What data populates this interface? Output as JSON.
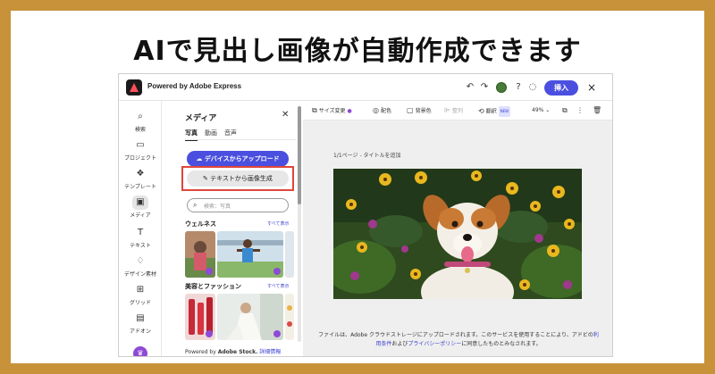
{
  "headline": "AIで見出し画像が自動作成できます",
  "app": {
    "title": "Powered by Adobe Express",
    "insert_label": "挿入",
    "close_icon": "×"
  },
  "nav": [
    {
      "label": "検索",
      "icon": "search-icon"
    },
    {
      "label": "プロジェクト",
      "icon": "folder-icon"
    },
    {
      "label": "テンプレート",
      "icon": "template-icon"
    },
    {
      "label": "メディア",
      "icon": "media-icon"
    },
    {
      "label": "テキスト",
      "icon": "text-icon"
    },
    {
      "label": "デザイン素材",
      "icon": "shapes-icon"
    },
    {
      "label": "グリッド",
      "icon": "grid-icon"
    },
    {
      "label": "アドオン",
      "icon": "addon-icon"
    }
  ],
  "panel": {
    "title": "メディア",
    "tabs": [
      "写真",
      "動画",
      "音声"
    ],
    "upload_button": "デバイスからアップロード",
    "generate_button": "テキストから画像生成",
    "search_placeholder": "検索：写真",
    "sections": [
      {
        "title": "ウェルネス",
        "link": "すべて表示"
      },
      {
        "title": "美容とファッション",
        "link": "すべて表示"
      }
    ],
    "footer_prefix": "Powered by ",
    "footer_brand": "Adobe Stock.",
    "footer_link": "詳細情報"
  },
  "toolbar": {
    "resize": "サイズ変更",
    "color": "配色",
    "background": "背景色",
    "arrange": "整列",
    "translate": "翻訳",
    "new_badge": "NEW",
    "zoom": "49%"
  },
  "canvas": {
    "page_label": "1/1ページ - タイトルを追加",
    "notice_line1_a": "ファイルは、Adobe クラウドストレージにアップロードされます。このサービスを使用することにより、アドビの",
    "notice_link1_a": "利",
    "notice_link1_b": "用条件",
    "notice_line2_a": "および",
    "notice_link2": "プライバシーポリシー",
    "notice_line2_b": "に同意したものとみなされます。"
  },
  "colors": {
    "frame": "#c8923a",
    "accent": "#4a4fe0",
    "highlight": "#e0463a",
    "premium": "#8e4ad6"
  }
}
